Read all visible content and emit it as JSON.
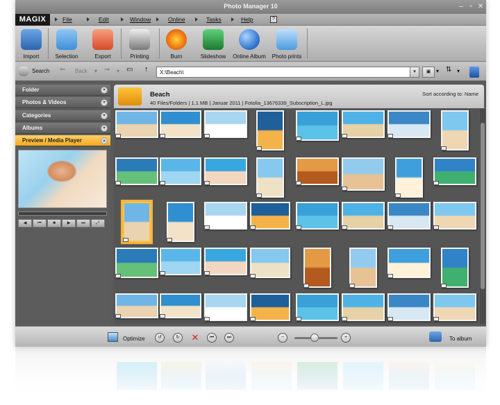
{
  "window": {
    "title": "Photo Manager 10"
  },
  "menubar": {
    "logo": "MAGIX",
    "items": [
      "File",
      "Edit",
      "Window",
      "Online",
      "Tasks",
      "Help"
    ]
  },
  "toolbar": {
    "buttons": [
      {
        "label": "Import",
        "icon": "camera-icon",
        "color": "#3a78c8"
      },
      {
        "label": "Selection",
        "icon": "selection-icon",
        "color": "#3d8fd8"
      },
      {
        "label": "Export",
        "icon": "export-icon",
        "color": "#d84a2a"
      },
      {
        "label": "Printing",
        "icon": "printer-icon",
        "color": "#555555"
      },
      {
        "label": "Burn",
        "icon": "burn-disc-icon",
        "color": "#e86a14"
      },
      {
        "label": "Slideshow",
        "icon": "slideshow-icon",
        "color": "#1f9a3a"
      },
      {
        "label": "Online Album",
        "icon": "globe-icon",
        "color": "#2b6fc9"
      },
      {
        "label": "Photo prints",
        "icon": "photo-prints-icon",
        "color": "#4a9be0"
      }
    ]
  },
  "addressbar": {
    "search_label": "Search",
    "back_label": "Back",
    "path": "X:\\Beach\\"
  },
  "leftpanel": {
    "sections": [
      {
        "label": "Folder",
        "active": false
      },
      {
        "label": "Photos & Videos",
        "active": false
      },
      {
        "label": "Categories",
        "active": false
      },
      {
        "label": "Albums",
        "active": false
      },
      {
        "label": "Preview / Media Player",
        "active": true
      }
    ]
  },
  "main": {
    "folder_name": "Beach",
    "folder_info": "40 Files/Folders | 1.1 MB | Januar 2011 | Fotolia_13676339_Subscription_L.jpg",
    "sort_label": "Sort according to: Name"
  },
  "bottombar": {
    "optimize_label": "Optimize",
    "to_album_label": "To album"
  },
  "colors": {
    "accent": "#f4a81c",
    "delete": "#d9201a"
  }
}
